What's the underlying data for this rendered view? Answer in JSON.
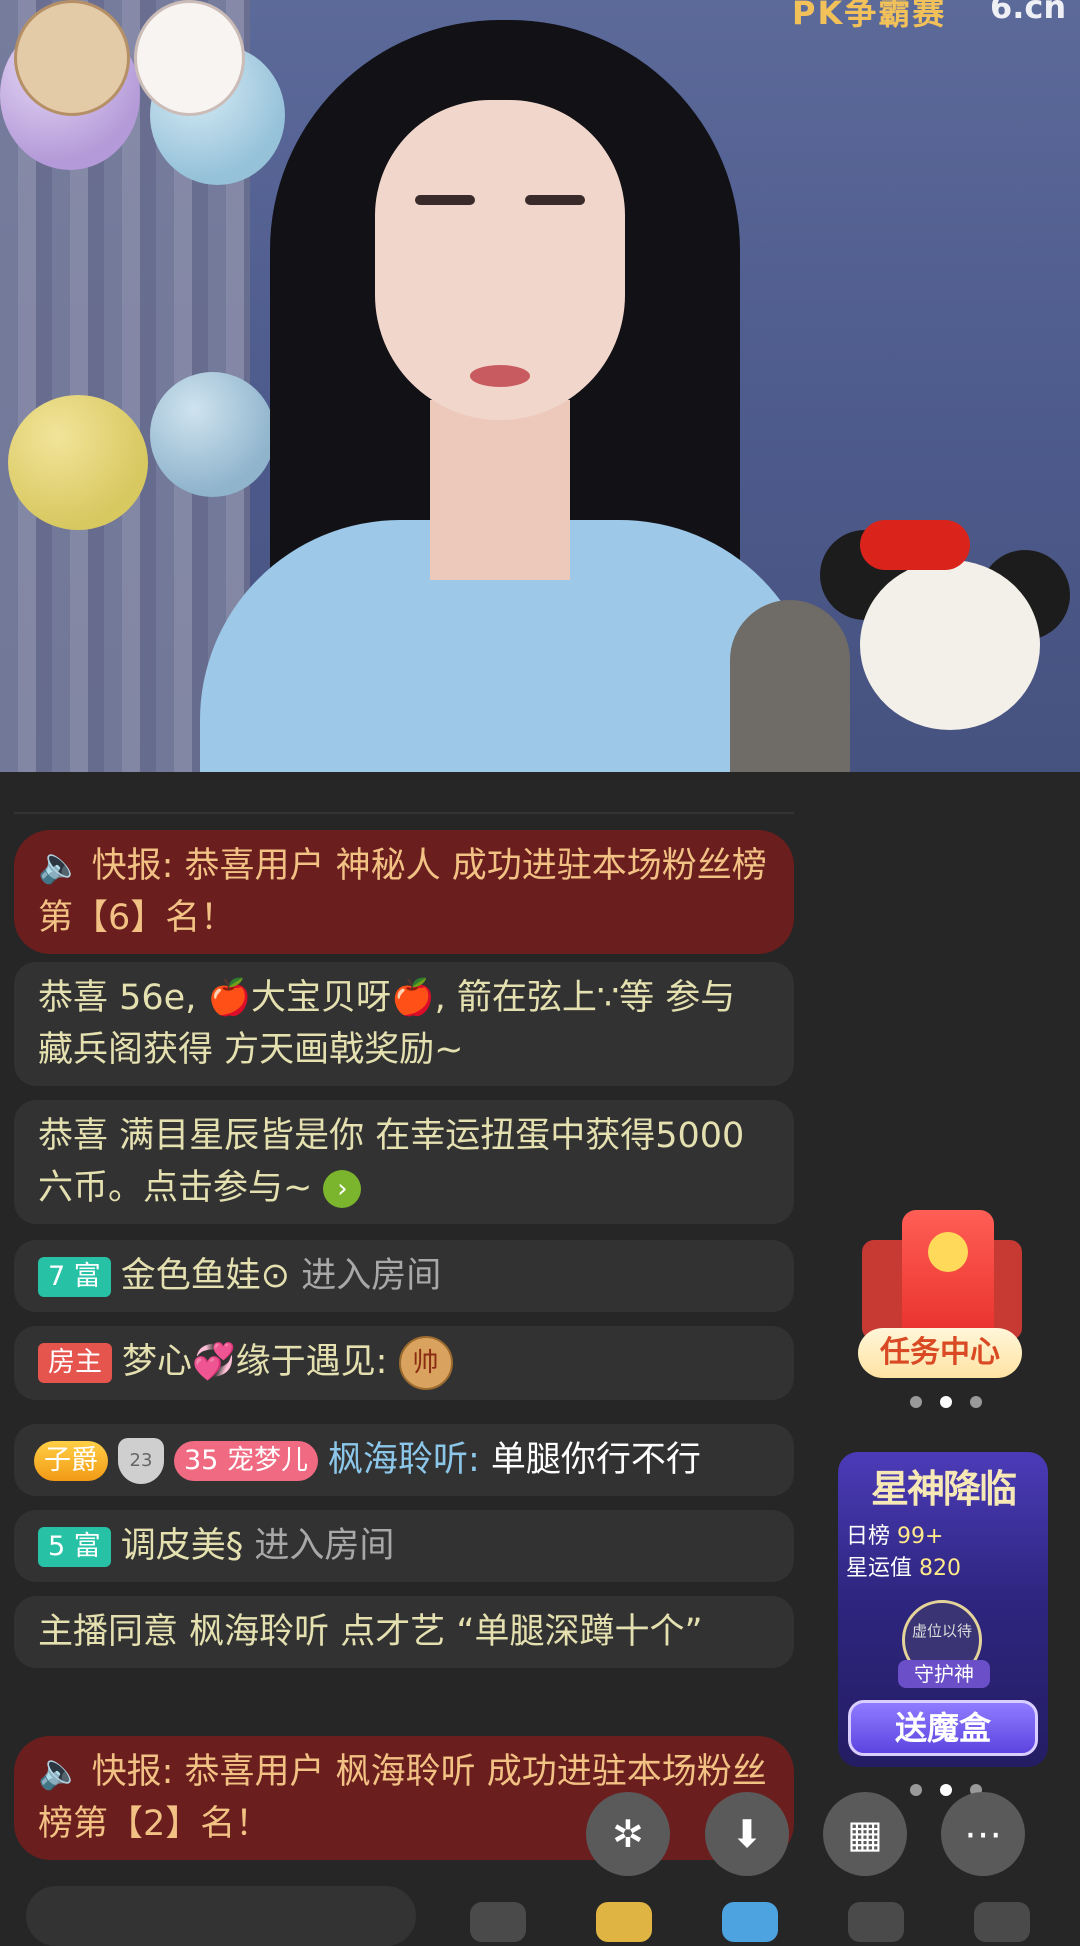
{
  "video": {
    "overlay_badge": "PK争霸赛",
    "overlay_logo": "6.cn"
  },
  "chat": {
    "messages": [
      {
        "type": "news",
        "icon": "speaker-icon",
        "text": "快报: 恭喜用户 神秘人 成功进驻本场粉丝榜第【6】名！"
      },
      {
        "type": "system",
        "text_a": "恭喜 56e, ",
        "apple": "🍎",
        "text_b": "大宝贝呀",
        "apple2": "🍎",
        "text_c": ", 箭在弦上∵等 参与藏兵阁获得 方天画戟奖励~"
      },
      {
        "type": "system",
        "text": "恭喜 满目星辰皆是你 在幸运扭蛋中获得5000六币。点击参与~",
        "link_icon": "›"
      },
      {
        "type": "enter",
        "tag": "7 富",
        "name": "金色鱼娃⊙",
        "action": "进入房间"
      },
      {
        "type": "owner",
        "tag": "房主",
        "name": "梦心💞缘于遇见:",
        "chess": "帅"
      },
      {
        "type": "user",
        "rank_tag": "子爵",
        "shield": "23",
        "pet_level": "35",
        "pet_tag": "宠梦儿",
        "name": "枫海聆听:",
        "text": "单腿你行不行"
      },
      {
        "type": "enter",
        "tag": "5 富",
        "name": "调皮美§",
        "action": "进入房间"
      },
      {
        "type": "system",
        "text": "主播同意 枫海聆听 点才艺 “单腿深蹲十个”"
      },
      {
        "type": "news",
        "icon": "speaker-icon",
        "text": "快报: 恭喜用户 枫海聆听 成功进驻本场粉丝榜第【2】名！"
      }
    ]
  },
  "widgets": {
    "task_center": "任务中心",
    "star": {
      "title": "星神降临",
      "daily_label": "日榜",
      "daily_value": "99+",
      "luck_label": "星运值",
      "luck_value": "820",
      "avatar_text": "虚位以待",
      "guard": "守护神",
      "send": "送魔盒"
    }
  },
  "fabs": [
    "✲",
    "⬇",
    "▦",
    "⋯"
  ],
  "colors": {
    "news_bg": "#6b1e1e",
    "msg_bg": "#323232",
    "text_gold": "#e4e0b0",
    "rich_tag": "#27c2a6",
    "owner_tag": "#e5544d"
  }
}
